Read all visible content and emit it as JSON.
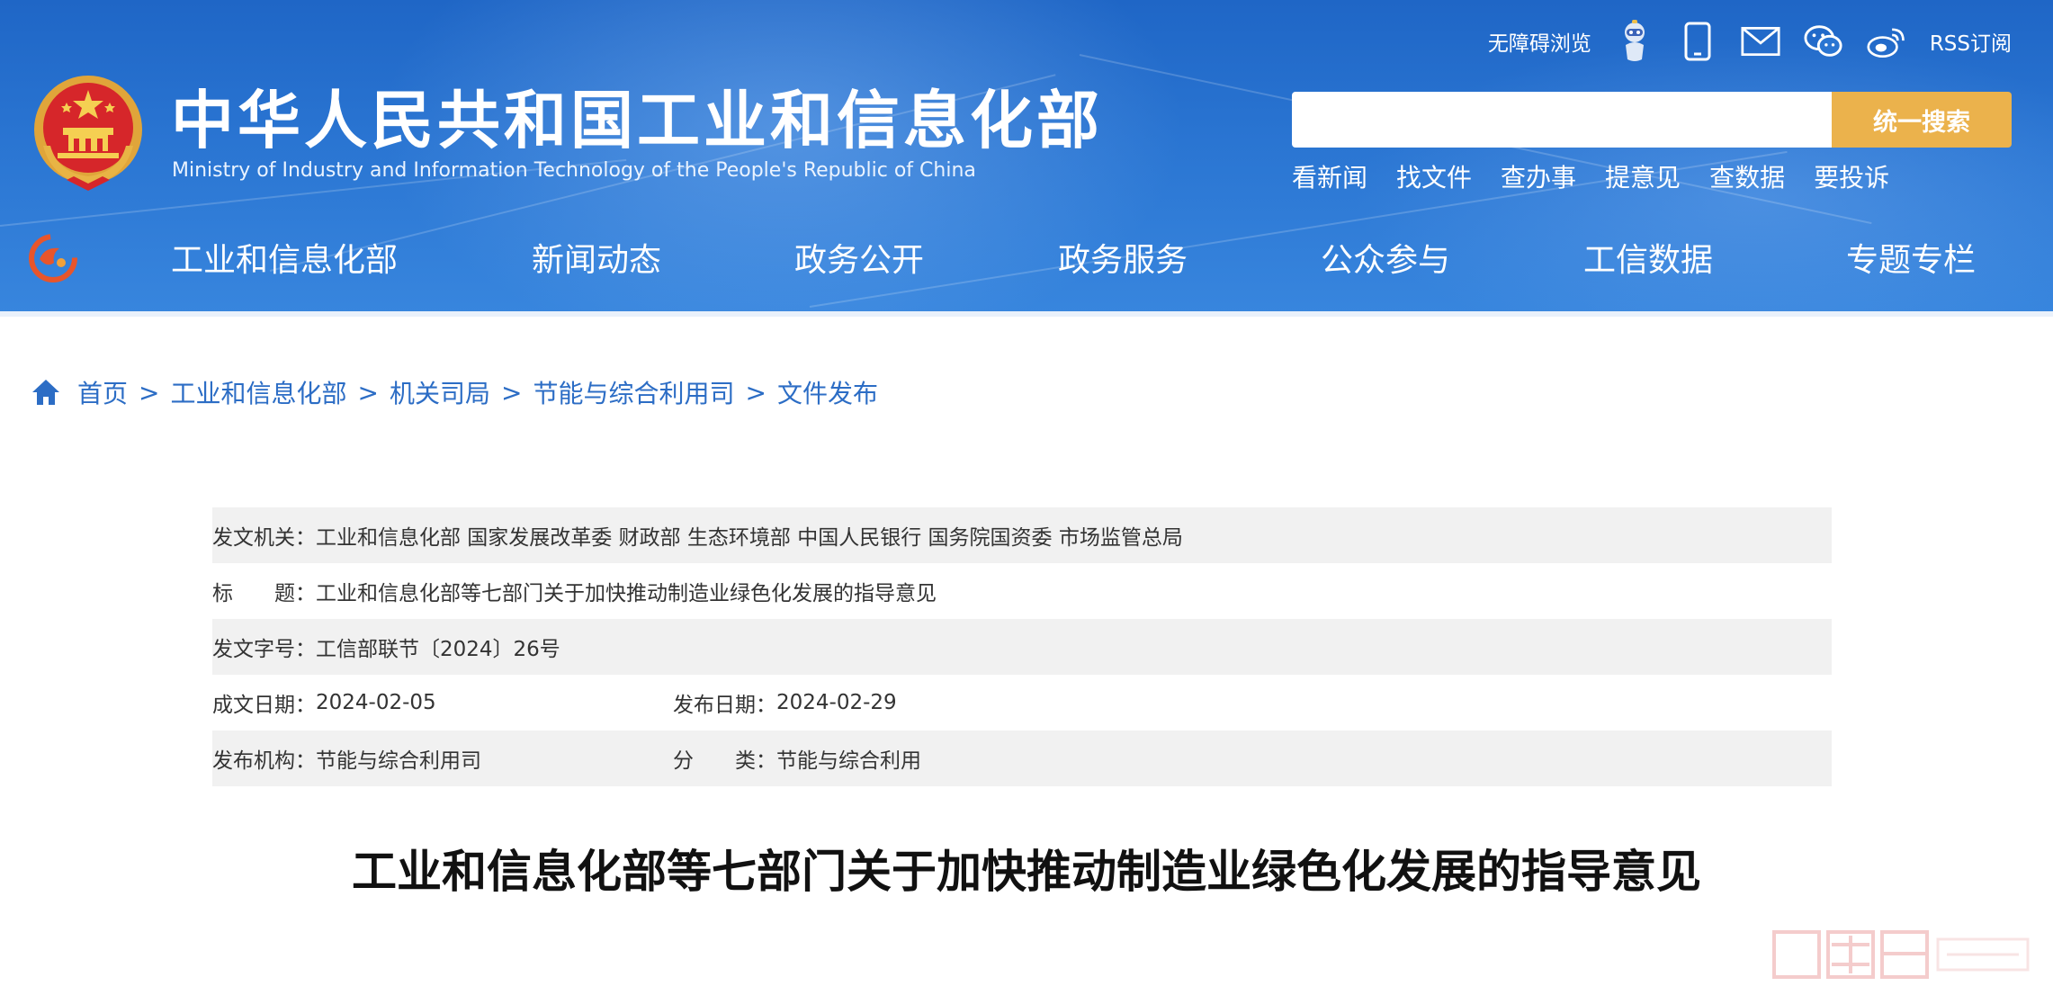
{
  "colors": {
    "header_blue": "#2a75d2",
    "search_button": "#ebb24c",
    "link_blue": "#2c6dc5",
    "row_shade": "#f1f1f1"
  },
  "header": {
    "site_title": "中华人民共和国工业和信息化部",
    "site_subtitle": "Ministry of Industry and Information Technology of the People's Republic of China",
    "emblem_icon": "national-emblem-icon",
    "top_links": {
      "accessibility": "无障碍浏览",
      "robot_icon": "robot-assistant-icon",
      "mobile_icon": "mobile-phone-icon",
      "mail_icon": "mail-icon",
      "wechat_icon": "wechat-icon",
      "weibo_icon": "weibo-icon",
      "rss": "RSS订阅"
    },
    "search": {
      "placeholder": "",
      "button_label": "统一搜索"
    },
    "quick_links": [
      "看新闻",
      "找文件",
      "查办事",
      "提意见",
      "查数据",
      "要投诉"
    ]
  },
  "nav": {
    "logo_icon": "miit-logo-icon",
    "items": [
      "工业和信息化部",
      "新闻动态",
      "政务公开",
      "政务服务",
      "公众参与",
      "工信数据",
      "专题专栏"
    ]
  },
  "breadcrumb": {
    "home_icon": "home-icon",
    "items": [
      "首页",
      "工业和信息化部",
      "机关司局",
      "节能与综合利用司",
      "文件发布"
    ],
    "separator": ">"
  },
  "meta": {
    "issuer_label": "发文机关：",
    "issuer_value": "工业和信息化部 国家发展改革委 财政部 生态环境部 中国人民银行 国务院国资委 市场监管总局",
    "title_label": "标　　题：",
    "title_value": "工业和信息化部等七部门关于加快推动制造业绿色化发展的指导意见",
    "doc_no_label": "发文字号：",
    "doc_no_value": "工信部联节〔2024〕26号",
    "created_label": "成文日期：",
    "created_value": "2024-02-05",
    "published_label": "发布日期：",
    "published_value": "2024-02-29",
    "org_label": "发布机构：",
    "org_value": "节能与综合利用司",
    "category_label": "分　　类：",
    "category_value": "节能与综合利用"
  },
  "article": {
    "title": "工业和信息化部等七部门关于加快推动制造业绿色化发展的指导意见"
  },
  "watermark": {
    "text": "墨王牌防水网"
  }
}
